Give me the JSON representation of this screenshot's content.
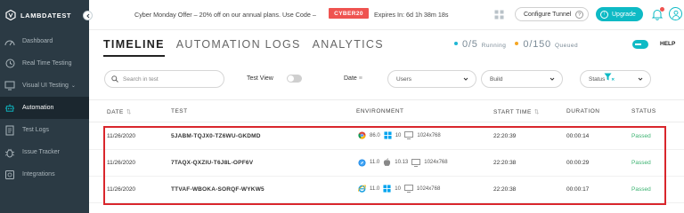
{
  "brand": {
    "name": "LAMBDATEST"
  },
  "sidebar": {
    "items": [
      {
        "label": "Dashboard",
        "icon": "dashboard-icon",
        "active": false
      },
      {
        "label": "Real Time Testing",
        "icon": "clock-icon",
        "active": false
      },
      {
        "label": "Visual UI Testing",
        "icon": "monitor-icon",
        "active": false,
        "has_submenu": true
      },
      {
        "label": "Automation",
        "icon": "robot-icon",
        "active": true
      },
      {
        "label": "Test Logs",
        "icon": "logs-icon",
        "active": false
      },
      {
        "label": "Issue Tracker",
        "icon": "bug-icon",
        "active": false
      },
      {
        "label": "Integrations",
        "icon": "integrations-icon",
        "active": false
      }
    ]
  },
  "topbar": {
    "offer_text": "Cyber Monday Offer – 20% off on our annual plans. Use Code –",
    "coupon_code": "CYBER20",
    "expires_text": "Expires In: 6d 1h 38m 18s",
    "tunnel_label": "Configure Tunnel",
    "tunnel_help": "?",
    "upgrade_label": "Upgrade"
  },
  "tabs": [
    {
      "label": "TIMELINE",
      "active": true
    },
    {
      "label": "AUTOMATION LOGS",
      "active": false
    },
    {
      "label": "ANALYTICS",
      "active": false
    }
  ],
  "stats": {
    "running_value": "0/5",
    "running_label": "Running",
    "running_color": "#1fb6d4",
    "queued_value": "0/150",
    "queued_label": "Queued",
    "queued_color": "#f5a623"
  },
  "help_label": "HELP",
  "filters": {
    "search_placeholder": "Search in test",
    "test_view_label": "Test View",
    "date_label": "Date",
    "users_label": "Users",
    "build_label": "Build",
    "status_label": "Status"
  },
  "table": {
    "headers": {
      "date": "DATE",
      "test": "TEST",
      "environment": "ENVIRONMENT",
      "start_time": "START TIME",
      "duration": "DURATION",
      "status": "STATUS"
    },
    "rows": [
      {
        "date": "11/26/2020",
        "test": "5JABM-TQJX0-TZ6WU-GKDMD",
        "browser_icon": "chrome-icon",
        "browser_version": "86.0",
        "os_icon": "windows-icon",
        "os_version": "10",
        "resolution": "1024x768",
        "start_time": "22:20:39",
        "duration": "00:00:14",
        "status": "Passed"
      },
      {
        "date": "11/26/2020",
        "test": "7TAQX-QXZIU-T6J8L-OPF6V",
        "browser_icon": "safari-icon",
        "browser_version": "11.0",
        "os_icon": "apple-icon",
        "os_version": "10.13",
        "resolution": "1024x768",
        "start_time": "22:20:38",
        "duration": "00:00:29",
        "status": "Passed"
      },
      {
        "date": "11/26/2020",
        "test": "TTVAF-WBOKA-SORQF-WYKW5",
        "browser_icon": "ie-icon",
        "browser_version": "11.0",
        "os_icon": "windows-icon",
        "os_version": "10",
        "resolution": "1024x768",
        "start_time": "22:20:38",
        "duration": "00:00:17",
        "status": "Passed"
      }
    ]
  },
  "colors": {
    "sidebar_bg": "#2b3a44",
    "accent": "#0ebac5",
    "coupon_bg": "#ef5350",
    "passed": "#3cb371",
    "highlight": "#d9262c"
  }
}
